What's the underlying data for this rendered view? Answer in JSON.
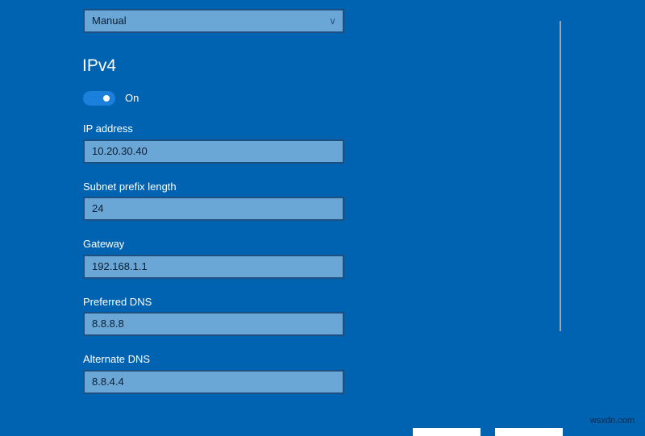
{
  "settings": {
    "dropdown_value": "Manual",
    "section_title": "IPv4",
    "toggle_label": "On",
    "toggle_on": true
  },
  "fields": [
    {
      "label": "IP address",
      "value": "10.20.30.40"
    },
    {
      "label": "Subnet prefix length",
      "value": "24"
    },
    {
      "label": "Gateway",
      "value": "192.168.1.1"
    },
    {
      "label": "Preferred DNS",
      "value": "8.8.8.8"
    },
    {
      "label": "Alternate DNS",
      "value": "8.8.4.4"
    }
  ],
  "watermark": "wsxdn.com"
}
